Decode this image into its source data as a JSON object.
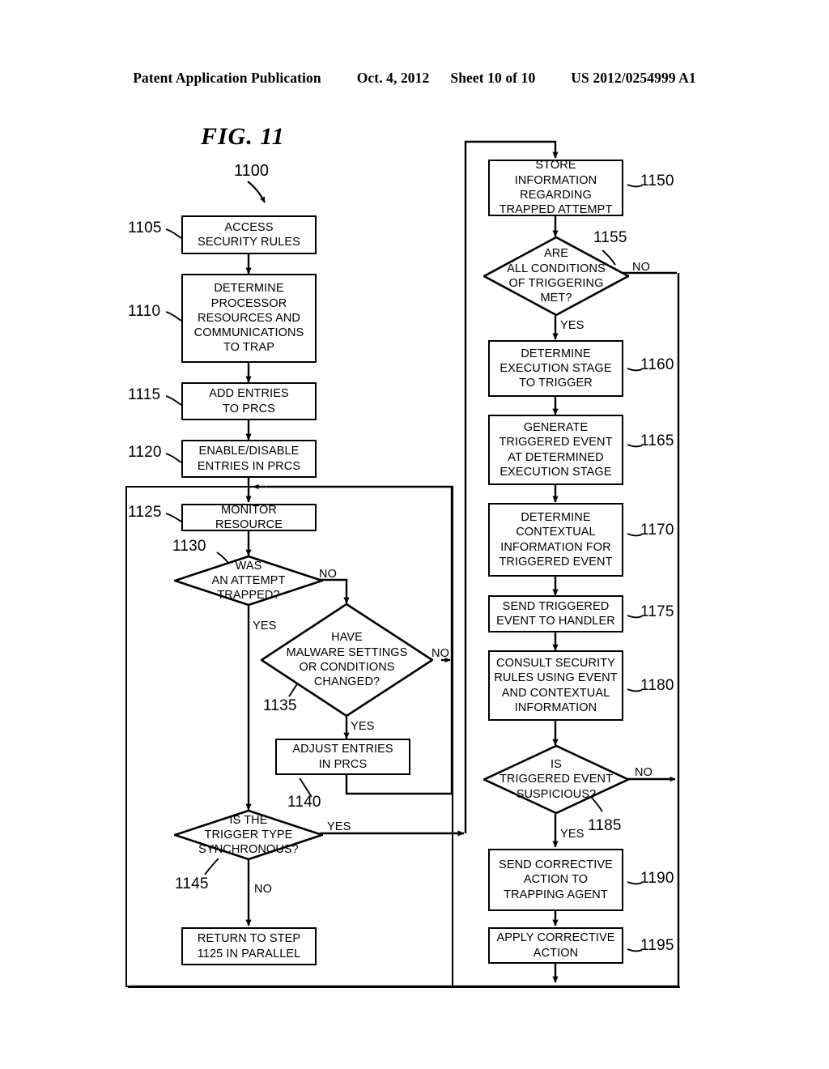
{
  "header": {
    "publication": "Patent Application Publication",
    "date": "Oct. 4, 2012",
    "sheet": "Sheet 10 of 10",
    "docnum": "US 2012/0254999 A1"
  },
  "figure": {
    "label": "FIG. 11",
    "top_ref": "1100"
  },
  "nodes": {
    "n1105": {
      "ref": "1105",
      "text": "ACCESS\nSECURITY RULES",
      "type": "process"
    },
    "n1110": {
      "ref": "1110",
      "text": "DETERMINE\nPROCESSOR\nRESOURCES AND\nCOMMUNICATIONS\nTO TRAP",
      "type": "process"
    },
    "n1115": {
      "ref": "1115",
      "text": "ADD ENTRIES\nTO PRCS",
      "type": "process"
    },
    "n1120": {
      "ref": "1120",
      "text": "ENABLE/DISABLE\nENTRIES IN PRCS",
      "type": "process"
    },
    "n1125": {
      "ref": "1125",
      "text": "MONITOR RESOURCE",
      "type": "process"
    },
    "n1130": {
      "ref": "1130",
      "text": "WAS\nAN ATTEMPT\nTRAPPED?",
      "type": "decision"
    },
    "n1135": {
      "ref": "1135",
      "text": "HAVE\nMALWARE SETTINGS\nOR CONDITIONS\nCHANGED?",
      "type": "decision"
    },
    "n1140": {
      "ref": "1140",
      "text": "ADJUST ENTRIES\nIN PRCS",
      "type": "process"
    },
    "n1145": {
      "ref": "1145",
      "text": "IS THE\nTRIGGER TYPE\nSYNCHRONOUS?",
      "type": "decision"
    },
    "n_return": {
      "ref": "",
      "text": "RETURN TO STEP\n1125 IN PARALLEL",
      "type": "process"
    },
    "n1150": {
      "ref": "1150",
      "text": "STORE INFORMATION\nREGARDING\nTRAPPED ATTEMPT",
      "type": "process"
    },
    "n1155": {
      "ref": "1155",
      "text": "ARE\nALL CONDITIONS\nOF TRIGGERING\nMET?",
      "type": "decision"
    },
    "n1160": {
      "ref": "1160",
      "text": "DETERMINE\nEXECUTION STAGE\nTO TRIGGER",
      "type": "process"
    },
    "n1165": {
      "ref": "1165",
      "text": "GENERATE\nTRIGGERED EVENT\nAT DETERMINED\nEXECUTION STAGE",
      "type": "process"
    },
    "n1170": {
      "ref": "1170",
      "text": "DETERMINE\nCONTEXTUAL\nINFORMATION FOR\nTRIGGERED EVENT",
      "type": "process"
    },
    "n1175": {
      "ref": "1175",
      "text": "SEND TRIGGERED\nEVENT TO HANDLER",
      "type": "process"
    },
    "n1180": {
      "ref": "1180",
      "text": "CONSULT SECURITY\nRULES USING EVENT\nAND CONTEXTUAL\nINFORMATION",
      "type": "process"
    },
    "n1185": {
      "ref": "1185",
      "text": "IS\nTRIGGERED EVENT\nSUSPICIOUS?",
      "type": "decision"
    },
    "n1190": {
      "ref": "1190",
      "text": "SEND CORRECTIVE\nACTION TO\nTRAPPING AGENT",
      "type": "process"
    },
    "n1195": {
      "ref": "1195",
      "text": "APPLY CORRECTIVE\nACTION",
      "type": "process"
    }
  },
  "branch_labels": {
    "b1130_no": "NO",
    "b1130_yes": "YES",
    "b1135_no": "NO",
    "b1135_yes": "YES",
    "b1145_yes": "YES",
    "b1145_no": "NO",
    "b1155_no": "NO",
    "b1155_yes": "YES",
    "b1185_no": "NO",
    "b1185_yes": "YES"
  },
  "colors": {
    "ink": "#000000",
    "paper": "#ffffff"
  }
}
